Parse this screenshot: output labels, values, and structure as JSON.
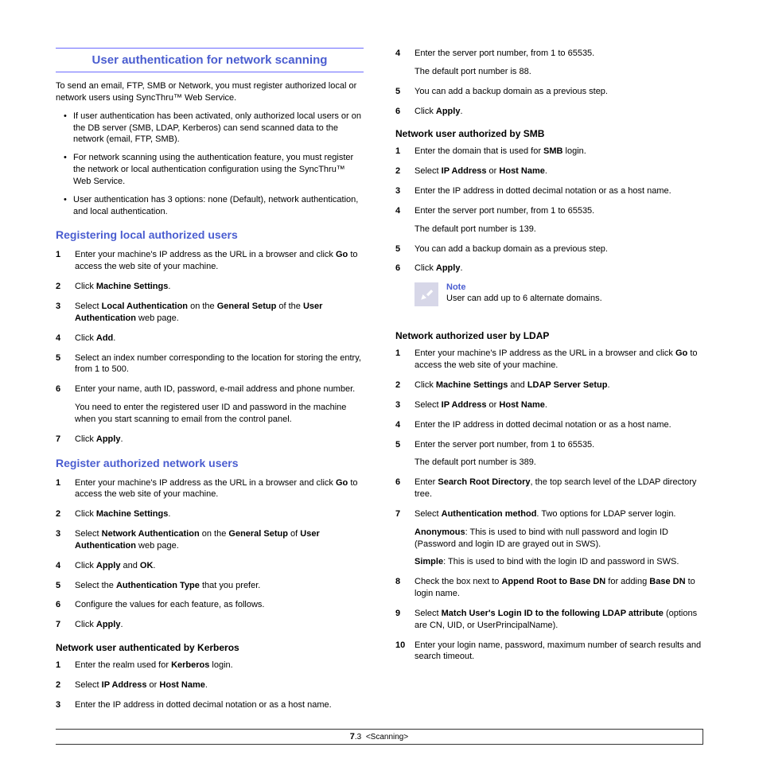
{
  "title": "User authentication for network scanning",
  "intro": "To send an email, FTP, SMB or Network, you must register authorized local or network users using SyncThru™ Web Service.",
  "bullets": [
    "If user authentication has been activated, only authorized local users or on the DB server (SMB, LDAP, Kerberos) can send scanned data to the network (email, FTP, SMB).",
    "For network scanning using the authentication feature, you must register the network or local authentication configuration using the SyncThru™ Web Service.",
    "User authentication has 3 options: none (Default), network authentication, and local authentication."
  ],
  "sec1": {
    "heading": "Registering local authorized users",
    "steps": [
      {
        "n": "1",
        "html": "Enter your machine's IP address as the URL in a browser and click <b>Go</b> to access the web site of your machine."
      },
      {
        "n": "2",
        "html": "Click <b>Machine Settings</b>."
      },
      {
        "n": "3",
        "html": "Select <b>Local Authentication</b> on the  <b>General Setup</b> of the <b>User Authentication</b> web page."
      },
      {
        "n": "4",
        "html": "Click <b>Add</b>."
      },
      {
        "n": "5",
        "html": "Select an index number corresponding to the location for storing the entry, from 1 to 500."
      },
      {
        "n": "6",
        "html": "Enter your name, auth ID, password, e-mail address and phone number.",
        "extra": "You need to enter the registered user ID and password in the machine when you start scanning to email from the control panel."
      },
      {
        "n": "7",
        "html": "Click <b>Apply</b>."
      }
    ]
  },
  "sec2": {
    "heading": "Register authorized network users",
    "steps": [
      {
        "n": "1",
        "html": "Enter your machine's IP address as the URL in a browser and click <b>Go</b> to access the web site of your machine."
      },
      {
        "n": "2",
        "html": "Click <b>Machine Settings</b>."
      },
      {
        "n": "3",
        "html": "Select <b>Network Authentication</b> on the  <b>General Setup</b> of <b>User Authentication</b> web page."
      },
      {
        "n": "4",
        "html": "Click <b>Apply</b> and <b>OK</b>."
      },
      {
        "n": "5",
        "html": "Select the <b>Authentication Type</b> that you prefer."
      },
      {
        "n": "6",
        "html": "Configure the values for each feature, as follows."
      },
      {
        "n": "7",
        "html": "Click <b>Apply</b>."
      }
    ]
  },
  "kerberos": {
    "heading": "Network user authenticated by Kerberos",
    "steps": [
      {
        "n": "1",
        "html": "Enter the realm used for <b>Kerberos</b> login."
      },
      {
        "n": "2",
        "html": "Select <b>IP Address</b> or <b>Host Name</b>."
      },
      {
        "n": "3",
        "html": "Enter the IP address in dotted decimal notation or as a host name."
      },
      {
        "n": "4",
        "html": "Enter the server port number, from 1 to 65535.",
        "extra": "The default port number is 88."
      },
      {
        "n": "5",
        "html": "You can add a backup domain as a previous step."
      },
      {
        "n": "6",
        "html": "Click <b>Apply</b>."
      }
    ]
  },
  "smb": {
    "heading": "Network user authorized by SMB",
    "steps": [
      {
        "n": "1",
        "html": "Enter the domain that is used for <b>SMB</b> login."
      },
      {
        "n": "2",
        "html": "Select <b>IP Address</b> or <b>Host Name</b>."
      },
      {
        "n": "3",
        "html": "Enter the IP address in dotted decimal notation or as a host name."
      },
      {
        "n": "4",
        "html": "Enter the server port number, from 1 to 65535.",
        "extra": "The default port number is 139."
      },
      {
        "n": "5",
        "html": "You can add a backup domain as a previous step."
      },
      {
        "n": "6",
        "html": "Click <b>Apply</b>."
      }
    ]
  },
  "note": {
    "label": "Note",
    "text": "User can add up to 6 alternate domains."
  },
  "ldap": {
    "heading": "Network authorized user by LDAP",
    "steps": [
      {
        "n": "1",
        "html": "Enter your machine's IP address as the URL in a browser and click <b>Go</b> to access the web site of your machine."
      },
      {
        "n": "2",
        "html": "Click <b>Machine Settings</b> and <b>LDAP Server Setup</b>."
      },
      {
        "n": "3",
        "html": "Select <b>IP Address</b> or <b>Host Name</b>."
      },
      {
        "n": "4",
        "html": "Enter the IP address in dotted decimal notation or as a host name."
      },
      {
        "n": "5",
        "html": "Enter the server port number, from 1 to 65535.",
        "extra": "The default port number is 389."
      },
      {
        "n": "6",
        "html": "Enter <b>Search Root Directory</b>, the top search level of the LDAP directory tree."
      },
      {
        "n": "7",
        "html": "Select <b>Authentication method</b>. Two options for LDAP server login.",
        "extra": " <b>Anonymous</b>: This is used to bind with null password and login ID (Password and login ID are grayed out in SWS).",
        "extra2": "<b>Simple</b>: This is used to bind with the login ID and password in SWS."
      },
      {
        "n": "8",
        "html": "Check the box next to <b>Append Root to Base DN</b> for adding <b>Base DN</b> to login name."
      },
      {
        "n": "9",
        "html": "Select <b>Match User's Login ID to the following LDAP attribute</b> (options are CN, UID, or UserPrincipalName)."
      },
      {
        "n": "10",
        "html": "Enter your login name, password, maximum number of search results and search timeout."
      }
    ]
  },
  "footer": {
    "page": "7",
    "sub": ".3",
    "section": "<Scanning>"
  }
}
